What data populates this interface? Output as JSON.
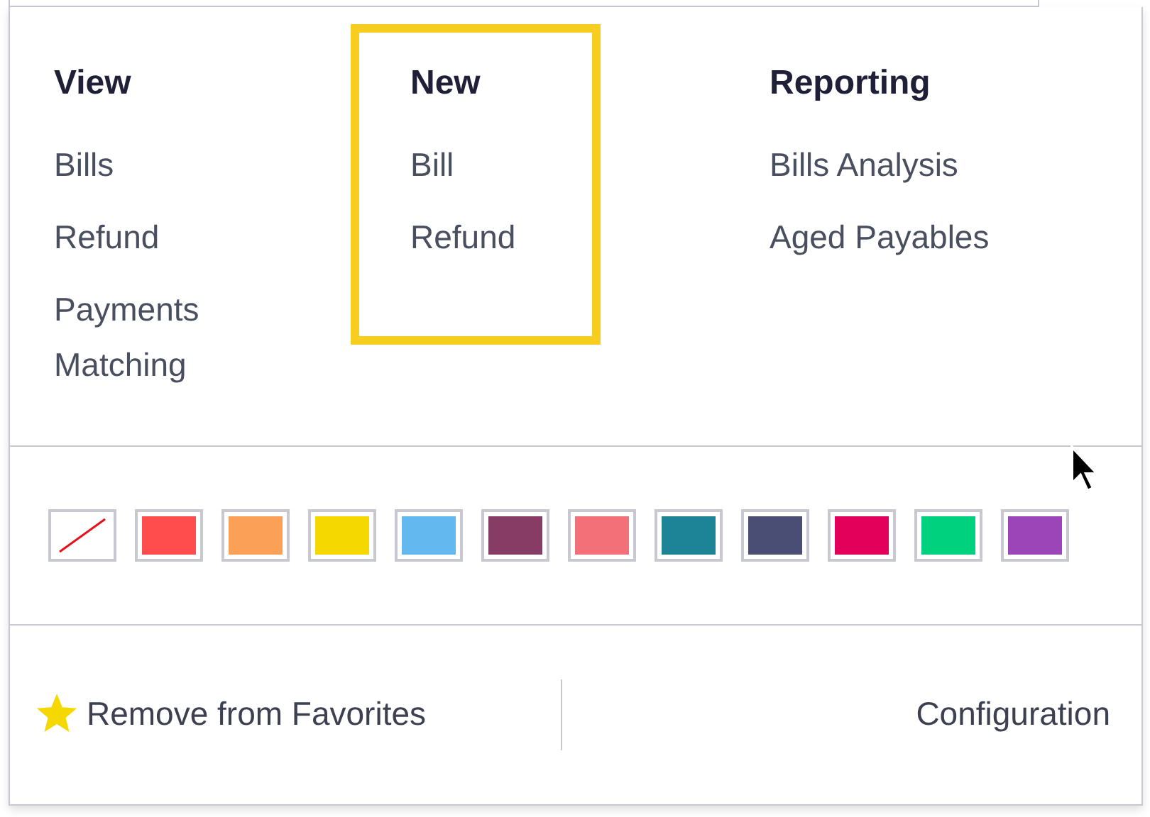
{
  "sections": [
    {
      "title": "View",
      "highlighted": false,
      "items": [
        "Bills",
        "Refund",
        "Payments Matching"
      ]
    },
    {
      "title": "New",
      "highlighted": true,
      "items": [
        "Bill",
        "Refund"
      ]
    },
    {
      "title": "Reporting",
      "highlighted": false,
      "items": [
        "Bills Analysis",
        "Aged Payables"
      ]
    }
  ],
  "colors": [
    {
      "kind": "none"
    },
    {
      "kind": "swatch",
      "color": "#ff4c4c"
    },
    {
      "kind": "swatch",
      "color": "#fba157"
    },
    {
      "kind": "swatch",
      "color": "#f5d800"
    },
    {
      "kind": "swatch",
      "color": "#63b9ef"
    },
    {
      "kind": "swatch",
      "color": "#863c64"
    },
    {
      "kind": "swatch",
      "color": "#f37079"
    },
    {
      "kind": "swatch",
      "color": "#1d8397"
    },
    {
      "kind": "swatch",
      "color": "#4a4e75"
    },
    {
      "kind": "swatch",
      "color": "#e3005a"
    },
    {
      "kind": "swatch",
      "color": "#00d17e"
    },
    {
      "kind": "swatch",
      "color": "#9b45b8"
    }
  ],
  "footer": {
    "favorite": {
      "label": "Remove from Favorites",
      "starred": true
    },
    "configuration": "Configuration"
  }
}
